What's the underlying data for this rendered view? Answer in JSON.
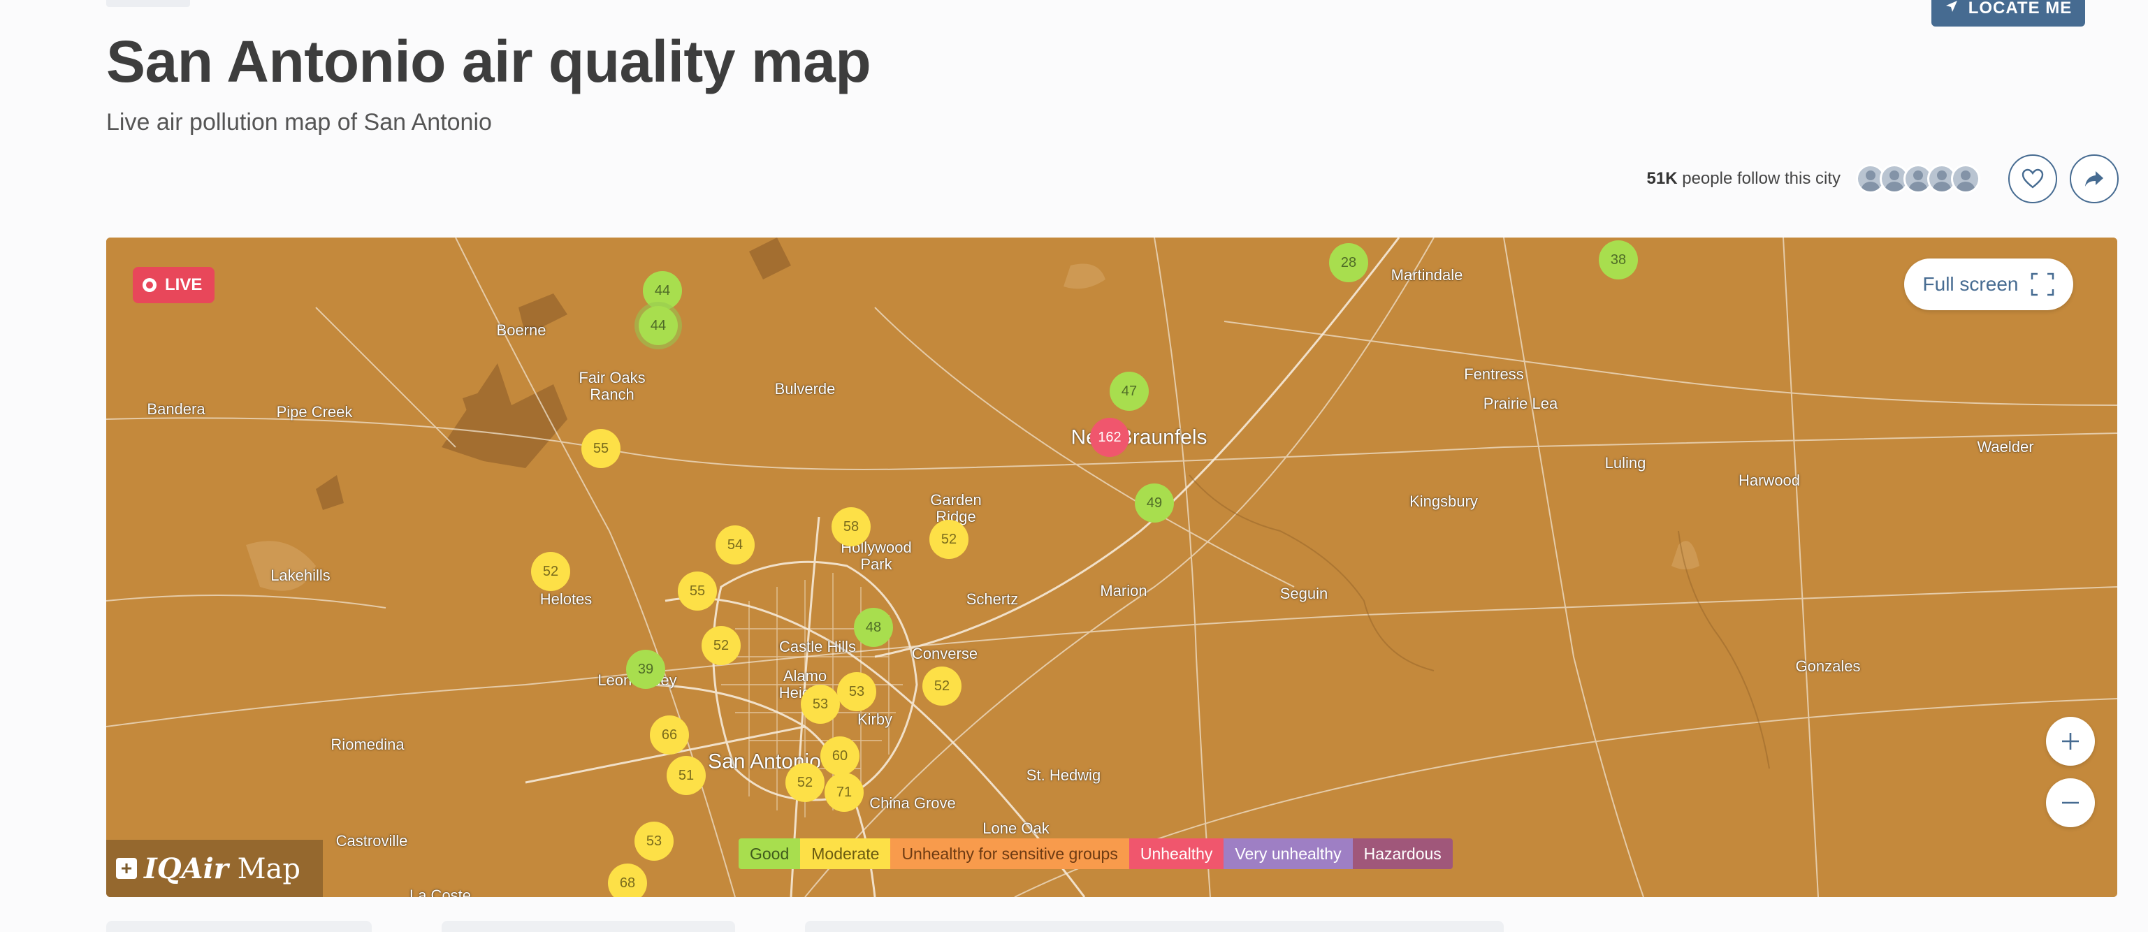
{
  "header": {
    "locate_label": "LOCATE ME",
    "title": "San Antonio air quality map",
    "subtitle": "Live air pollution map of San Antonio"
  },
  "follow": {
    "count": "51K",
    "text": "people follow this city"
  },
  "map": {
    "live_label": "LIVE",
    "fullscreen_label": "Full screen",
    "logo_brand": "IQAir",
    "logo_suffix": "Map",
    "places": [
      {
        "name": "Boerne"
      },
      {
        "name": "Fair Oaks Ranch"
      },
      {
        "name": "Bulverde"
      },
      {
        "name": "Bandera"
      },
      {
        "name": "Pipe Creek"
      },
      {
        "name": "Lakehills"
      },
      {
        "name": "Helotes"
      },
      {
        "name": "Garden Ridge"
      },
      {
        "name": "Hollywood Park"
      },
      {
        "name": "Schertz"
      },
      {
        "name": "Marion"
      },
      {
        "name": "Seguin"
      },
      {
        "name": "Converse"
      },
      {
        "name": "Leon Valley"
      },
      {
        "name": "Castle Hills"
      },
      {
        "name": "Alamo Heights"
      },
      {
        "name": "Kirby"
      },
      {
        "name": "Riomedina"
      },
      {
        "name": "San Antonio"
      },
      {
        "name": "China Grove"
      },
      {
        "name": "St. Hedwig"
      },
      {
        "name": "Lone Oak"
      },
      {
        "name": "Castroville"
      },
      {
        "name": "La Coste"
      },
      {
        "name": "New Braunfels"
      },
      {
        "name": "Martindale"
      },
      {
        "name": "Fentress"
      },
      {
        "name": "Prairie Lea"
      },
      {
        "name": "Luling"
      },
      {
        "name": "Harwood"
      },
      {
        "name": "Waelder"
      },
      {
        "name": "Kingsbury"
      },
      {
        "name": "Gonzales"
      }
    ],
    "markers": [
      {
        "aqi": "44",
        "level": "good"
      },
      {
        "aqi": "44",
        "level": "good"
      },
      {
        "aqi": "28",
        "level": "good"
      },
      {
        "aqi": "38",
        "level": "good"
      },
      {
        "aqi": "47",
        "level": "good"
      },
      {
        "aqi": "162",
        "level": "unhealthy"
      },
      {
        "aqi": "49",
        "level": "good"
      },
      {
        "aqi": "55",
        "level": "moderate"
      },
      {
        "aqi": "54",
        "level": "moderate"
      },
      {
        "aqi": "58",
        "level": "moderate"
      },
      {
        "aqi": "52",
        "level": "moderate"
      },
      {
        "aqi": "52",
        "level": "moderate"
      },
      {
        "aqi": "55",
        "level": "moderate"
      },
      {
        "aqi": "48",
        "level": "good"
      },
      {
        "aqi": "52",
        "level": "moderate"
      },
      {
        "aqi": "39",
        "level": "good"
      },
      {
        "aqi": "53",
        "level": "moderate"
      },
      {
        "aqi": "53",
        "level": "moderate"
      },
      {
        "aqi": "52",
        "level": "moderate"
      },
      {
        "aqi": "66",
        "level": "moderate"
      },
      {
        "aqi": "60",
        "level": "moderate"
      },
      {
        "aqi": "51",
        "level": "moderate"
      },
      {
        "aqi": "52",
        "level": "moderate"
      },
      {
        "aqi": "71",
        "level": "moderate"
      },
      {
        "aqi": "53",
        "level": "moderate"
      },
      {
        "aqi": "68",
        "level": "moderate"
      }
    ],
    "legend": [
      "Good",
      "Moderate",
      "Unhealthy for sensitive groups",
      "Unhealthy",
      "Very unhealthy",
      "Hazardous"
    ],
    "colors": {
      "good": "#a8de4e",
      "moderate": "#fde047",
      "usg": "#f89b4c",
      "unhealthy": "#f0566d",
      "very_unhealthy": "#9e7fc4",
      "hazardous": "#a0577a",
      "map_tint": "#c4893c",
      "accent": "#466b91"
    }
  }
}
